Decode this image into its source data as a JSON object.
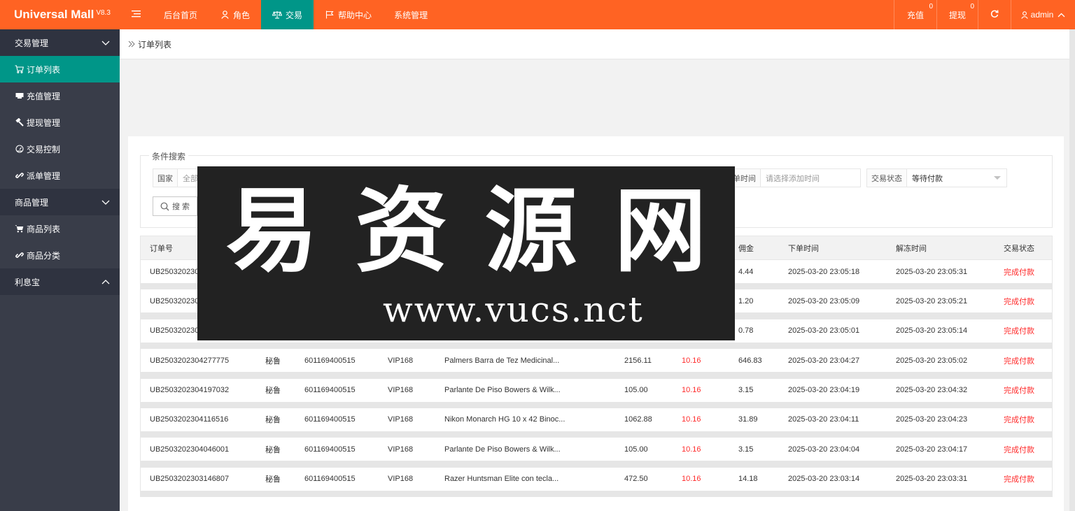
{
  "header": {
    "brand": "Universal Mall",
    "version": "V8.3",
    "menu_icon": "list-icon",
    "nav": [
      {
        "label": "后台首页",
        "icon": ""
      },
      {
        "label": "角色",
        "icon": "user-icon"
      },
      {
        "label": "交易",
        "icon": "scale-icon",
        "active": true
      },
      {
        "label": "帮助中心",
        "icon": "flag-icon"
      },
      {
        "label": "系统管理",
        "icon": ""
      }
    ],
    "recharge_label": "充值",
    "recharge_count": "0",
    "withdraw_label": "提现",
    "withdraw_count": "0",
    "refresh_icon": "refresh-icon",
    "user_label": "admin",
    "accent_color": "#ff6323",
    "active_color": "#009688"
  },
  "sidebar": {
    "groups": [
      {
        "label": "交易管理",
        "expanded": true
      },
      {
        "label": "商品管理",
        "expanded": true
      },
      {
        "label": "利息宝",
        "expanded": false
      }
    ],
    "trade_items": [
      {
        "label": "订单列表",
        "icon": "cart-icon",
        "active": true
      },
      {
        "label": "充值管理",
        "icon": "card-icon"
      },
      {
        "label": "提现管理",
        "icon": "hammer-icon"
      },
      {
        "label": "交易控制",
        "icon": "gauge-icon"
      },
      {
        "label": "派单管理",
        "icon": "link-icon"
      }
    ],
    "goods_items": [
      {
        "label": "商品列表",
        "icon": "cart-icon"
      },
      {
        "label": "商品分类",
        "icon": "link-icon"
      }
    ]
  },
  "breadcrumb": {
    "label": "订单列表"
  },
  "search": {
    "legend": "条件搜索",
    "country_label": "国家",
    "country_value": "全部",
    "time_label": "下单时间",
    "time_placeholder": "请选择添加时间",
    "status_label": "交易状态",
    "status_value": "等待付款",
    "button_label": "搜 索"
  },
  "table": {
    "columns": [
      "订单号",
      "佣金",
      "下单时间",
      "解冻时间",
      "交易状态"
    ],
    "rows": [
      {
        "order": "UB250320230",
        "country": "",
        "account": "",
        "level": "",
        "product": "",
        "amount": "",
        "rate": "",
        "commission": "4.44",
        "order_time": "2025-03-20 23:05:18",
        "unfreeze_time": "2025-03-20 23:05:31",
        "status": "完成付款"
      },
      {
        "order": "UB250320230",
        "country": "",
        "account": "",
        "level": "",
        "product": "",
        "amount": "",
        "rate": "",
        "commission": "1.20",
        "order_time": "2025-03-20 23:05:09",
        "unfreeze_time": "2025-03-20 23:05:21",
        "status": "完成付款"
      },
      {
        "order": "UB250320230",
        "country": "",
        "account": "",
        "level": "",
        "product": "",
        "amount": "",
        "rate": "",
        "commission": "0.78",
        "order_time": "2025-03-20 23:05:01",
        "unfreeze_time": "2025-03-20 23:05:14",
        "status": "完成付款"
      },
      {
        "order": "UB2503202304277775",
        "country": "秘鲁",
        "account": "601169400515",
        "level": "VIP168",
        "product": "Palmers Barra de Tez Medicinal...",
        "amount": "2156.11",
        "rate": "10.16",
        "commission": "646.83",
        "order_time": "2025-03-20 23:04:27",
        "unfreeze_time": "2025-03-20 23:05:02",
        "status": "完成付款"
      },
      {
        "order": "UB2503202304197032",
        "country": "秘鲁",
        "account": "601169400515",
        "level": "VIP168",
        "product": "Parlante De Piso Bowers & Wilk...",
        "amount": "105.00",
        "rate": "10.16",
        "commission": "3.15",
        "order_time": "2025-03-20 23:04:19",
        "unfreeze_time": "2025-03-20 23:04:32",
        "status": "完成付款"
      },
      {
        "order": "UB2503202304116516",
        "country": "秘鲁",
        "account": "601169400515",
        "level": "VIP168",
        "product": "Nikon Monarch HG 10 x 42 Binoc...",
        "amount": "1062.88",
        "rate": "10.16",
        "commission": "31.89",
        "order_time": "2025-03-20 23:04:11",
        "unfreeze_time": "2025-03-20 23:04:23",
        "status": "完成付款"
      },
      {
        "order": "UB2503202304046001",
        "country": "秘鲁",
        "account": "601169400515",
        "level": "VIP168",
        "product": "Parlante De Piso Bowers & Wilk...",
        "amount": "105.00",
        "rate": "10.16",
        "commission": "3.15",
        "order_time": "2025-03-20 23:04:04",
        "unfreeze_time": "2025-03-20 23:04:17",
        "status": "完成付款"
      },
      {
        "order": "UB2503202303146807",
        "country": "秘鲁",
        "account": "601169400515",
        "level": "VIP168",
        "product": "Razer Huntsman Elite con tecla...",
        "amount": "472.50",
        "rate": "10.16",
        "commission": "14.18",
        "order_time": "2025-03-20 23:03:14",
        "unfreeze_time": "2025-03-20 23:03:31",
        "status": "完成付款"
      }
    ],
    "status_color": "#ff2b2b"
  },
  "watermark": {
    "characters": [
      "易",
      "资",
      "源",
      "网"
    ],
    "url": "www.vucs.nct"
  }
}
